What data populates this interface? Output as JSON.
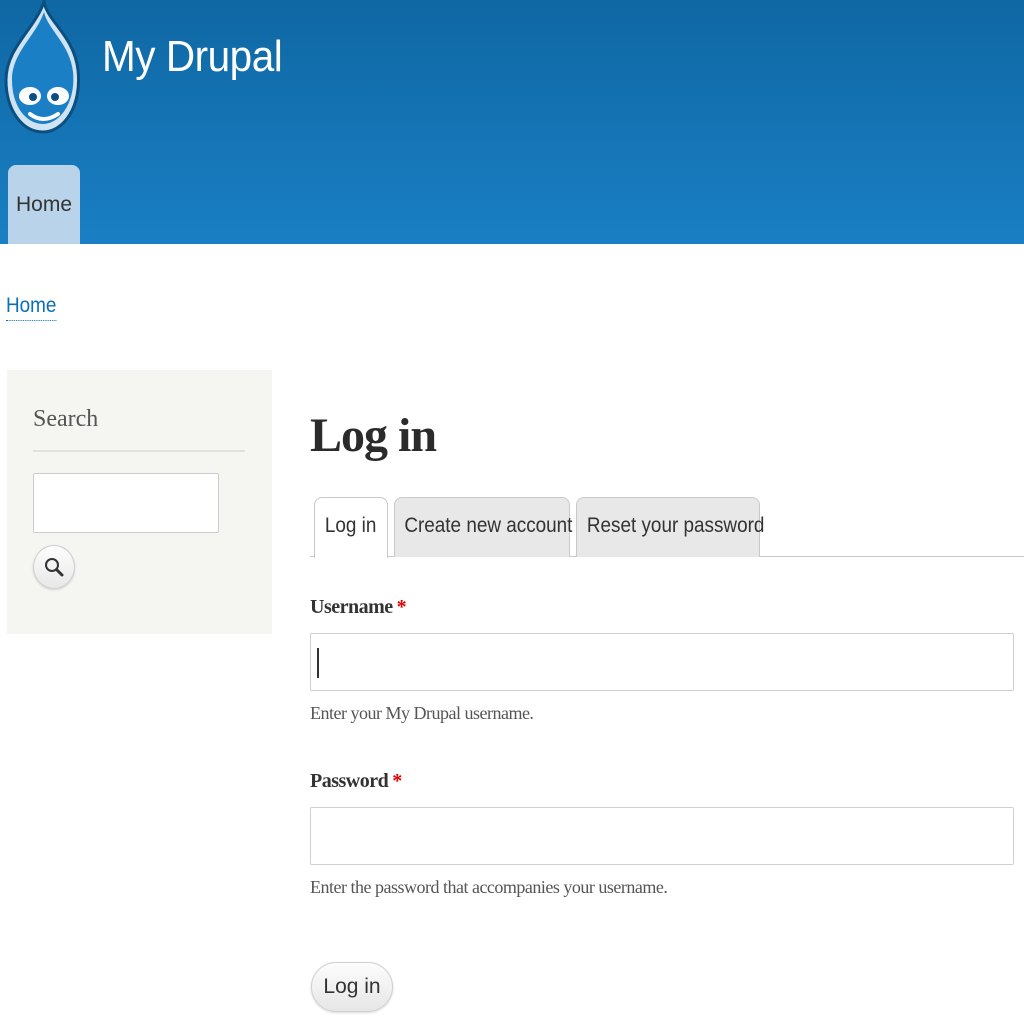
{
  "header": {
    "site_name": "My Drupal",
    "logo_icon": "drupal-drop-icon",
    "nav": [
      {
        "label": "Home"
      }
    ],
    "colors": {
      "top": "#0f67a3",
      "bottom": "#1a7fc4",
      "nav_tab": "#b9d4ea"
    }
  },
  "breadcrumb": {
    "home": "Home"
  },
  "sidebar": {
    "search_title": "Search",
    "search_value": "",
    "search_icon": "magnifier-icon"
  },
  "main": {
    "title": "Log in",
    "tabs": [
      {
        "label": "Log in",
        "active": true
      },
      {
        "label": "Create new account",
        "active": false
      },
      {
        "label": "Reset your password",
        "active": false
      }
    ],
    "username": {
      "label": "Username",
      "required_marker": "*",
      "value": "",
      "description": "Enter your My Drupal username."
    },
    "password": {
      "label": "Password",
      "required_marker": "*",
      "value": "",
      "description": "Enter the password that accompanies your username."
    },
    "submit_label": "Log in"
  }
}
